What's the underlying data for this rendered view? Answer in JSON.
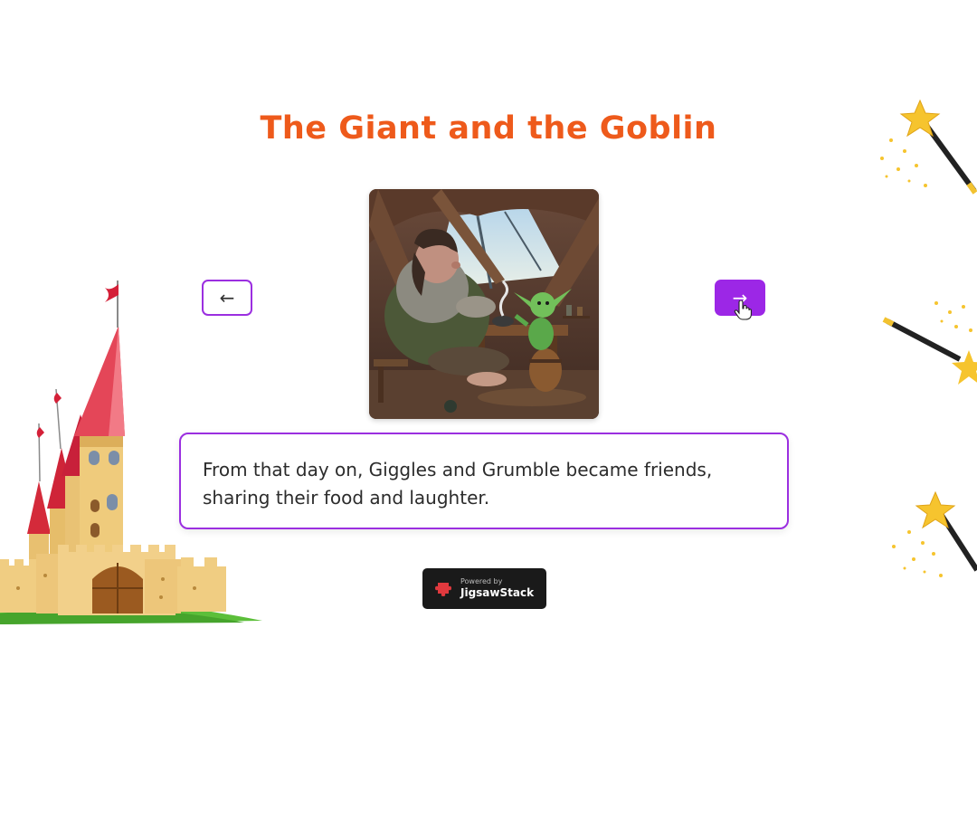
{
  "story": {
    "title": "The Giant and the Goblin",
    "text": "From that day on, Giggles and Grumble became friends, sharing their food and laughter."
  },
  "navigation": {
    "prev_label": "←",
    "next_label": "→"
  },
  "badge": {
    "powered_label": "Powered by",
    "brand": "JigsawStack"
  },
  "colors": {
    "title": "#ee5a1b",
    "accent": "#9c27e6",
    "badge_bg": "#1a1a1a",
    "brand_icon": "#e0393e"
  },
  "icons": {
    "cursor": "hand-pointer-icon",
    "brand": "jigsaw-icon",
    "castle": "castle-icon",
    "wand": "magic-wand-icon"
  }
}
